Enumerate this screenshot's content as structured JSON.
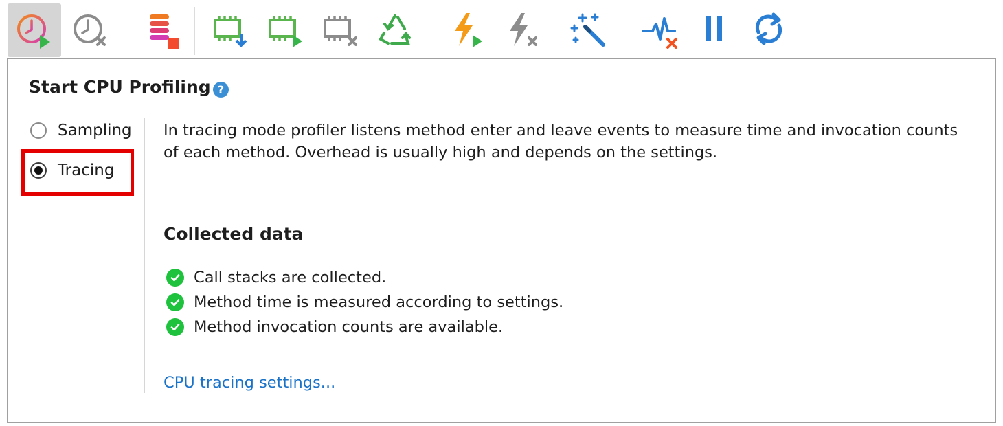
{
  "toolbar": {
    "buttons": [
      {
        "icon": "start-cpu-profiling-icon",
        "active": true
      },
      {
        "icon": "stop-cpu-profiling-icon"
      },
      {
        "icon": "start-object-allocation-recording-icon"
      },
      {
        "icon": "capture-memory-snapshot-icon"
      },
      {
        "icon": "start-memory-recording-icon"
      },
      {
        "icon": "stop-memory-recording-icon"
      },
      {
        "icon": "force-garbage-collection-icon"
      },
      {
        "icon": "start-events-recording-icon"
      },
      {
        "icon": "stop-events-recording-icon"
      },
      {
        "icon": "trigger-wizard-icon"
      },
      {
        "icon": "clear-telemetry-icon"
      },
      {
        "icon": "pause-icon"
      },
      {
        "icon": "refresh-icon"
      }
    ]
  },
  "panel": {
    "title": "Start CPU Profiling",
    "help_glyph": "?",
    "modes": [
      {
        "label": "Sampling",
        "checked": false
      },
      {
        "label": "Tracing",
        "checked": true
      }
    ],
    "description": "In tracing mode profiler listens method enter and leave events to measure time and invocation counts of each method. Overhead is usually high and depends on the settings.",
    "collected_title": "Collected data",
    "collected_items": [
      "Call stacks are collected.",
      "Method time is measured according to settings.",
      "Method invocation counts are available."
    ],
    "settings_link": "CPU tracing settings..."
  },
  "colors": {
    "accent_blue": "#1a73c8",
    "check_green": "#1ec23d",
    "highlight_red": "#e50000",
    "toolbar_active": "#d5d5d5"
  }
}
